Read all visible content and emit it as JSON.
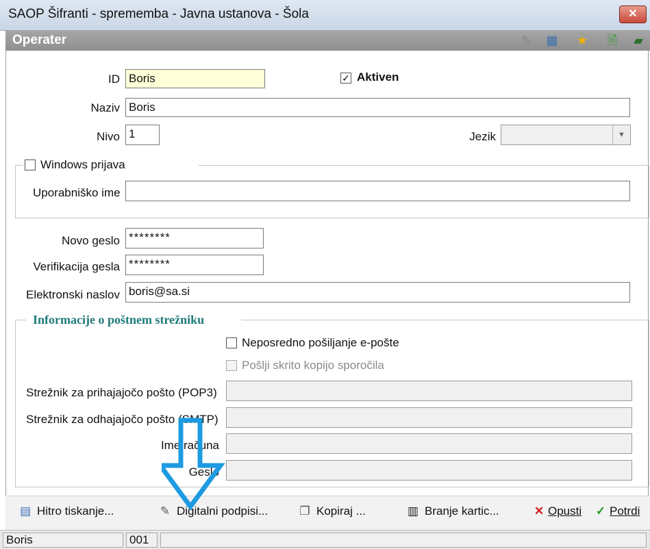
{
  "window": {
    "title": "SAOP Šifranti - sprememba - Javna ustanova - Šola",
    "close_label": "✕"
  },
  "header": {
    "title": "Operater",
    "toolbar_icons": [
      "edit-icon",
      "grid-icon",
      "star-icon",
      "document-check-icon",
      "books-icon"
    ]
  },
  "form": {
    "id_label": "ID",
    "id_value": "Boris",
    "active_label": "Aktiven",
    "active_checked": true,
    "naziv_label": "Naziv",
    "naziv_value": "Boris",
    "nivo_label": "Nivo",
    "nivo_value": "1",
    "jezik_label": "Jezik",
    "jezik_value": "",
    "windows_login": {
      "label": "Windows prijava",
      "checked": false,
      "username_label": "Uporabniško ime",
      "username_value": ""
    },
    "new_password_label": "Novo geslo",
    "new_password_value": "********",
    "verify_label": "Verifikacija gesla",
    "verify_value": "********",
    "email_label": "Elektronski naslov",
    "email_value": "boris@sa.si"
  },
  "mail_server": {
    "title": "Informacije o poštnem strežniku",
    "direct_send_label": "Neposredno pošiljanje e-pošte",
    "bcc_label": "Pošlji skrito kopijo sporočila",
    "pop3_label": "Strežnik za prihajajočo pošto (POP3)",
    "pop3_value": "",
    "smtp_label": "Strežnik za odhajajočo pošto (SMTP)",
    "smtp_value": "",
    "account_label": "Ime računa",
    "account_value": "",
    "password_label": "Geslo",
    "password_value": ""
  },
  "toolbar": {
    "quick_print": "Hitro tiskanje...",
    "digital_signatures": "Digitalni podpisi...",
    "copy": "Kopiraj ...",
    "card_reading": "Branje kartic...",
    "cancel": "Opusti",
    "confirm": "Potrdi"
  },
  "statusbar": {
    "user": "Boris",
    "code": "001"
  },
  "colors": {
    "annotation_arrow": "#1e9be0",
    "section_title": "#1f7a7a",
    "id_field_bg": "#ffffd8"
  }
}
